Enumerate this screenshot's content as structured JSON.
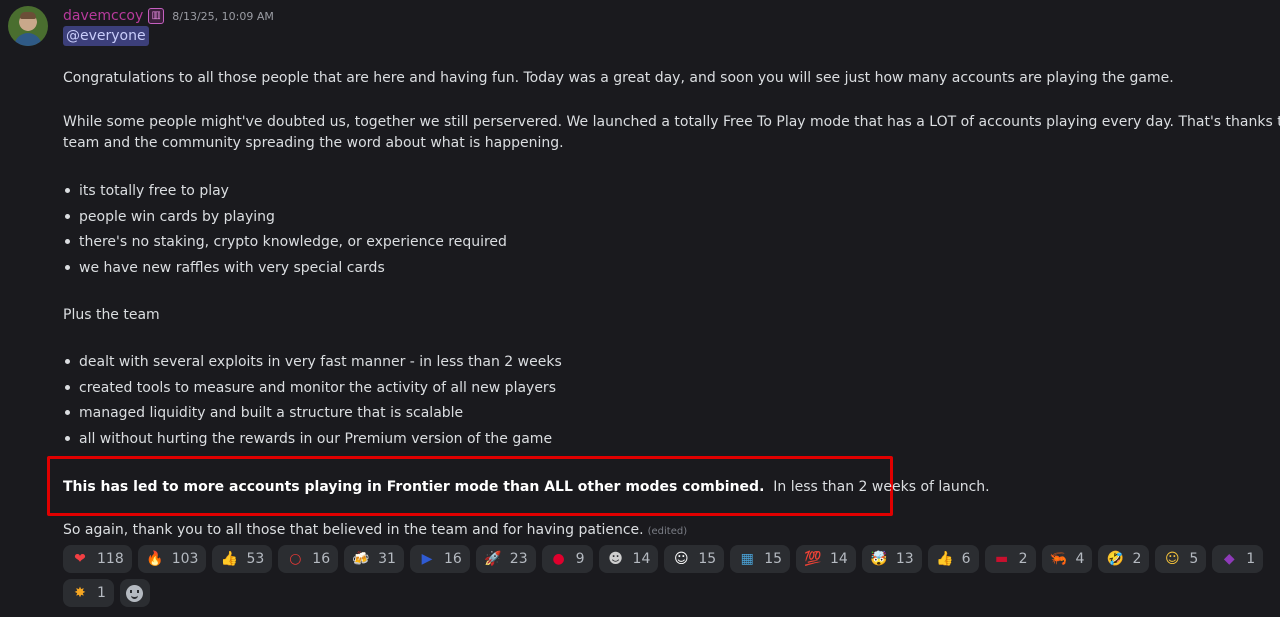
{
  "message": {
    "author": "davemccoy",
    "timestamp": "8/13/25, 10:09 AM",
    "mention": "@everyone",
    "paragraph1": "Congratulations to all those people that are here and having fun.  Today was a great day, and soon you will see just how many accounts are playing the game.",
    "paragraph2_line1": "While some people might've doubted us, together we still perservered.  We launched a totally Free To Play mode that has a LOT of accounts playing every day.  That's thanks to the",
    "paragraph2_line2": "team and the community spreading the word about what is happening.",
    "list1": [
      "its totally free to play",
      "people win cards by playing",
      "there's no staking, crypto knowledge, or experience required",
      "we have new raffles with very special cards"
    ],
    "plus_team": "Plus the team",
    "list2": [
      "dealt with several exploits in very fast manner - in less than 2 weeks",
      "created tools to measure and monitor the activity of all new players",
      "managed liquidity and built a structure that is scalable",
      "all without hurting the rewards in our Premium version of the game"
    ],
    "highlight_bold": "This has led to more accounts playing in Frontier mode than ALL other modes combined.",
    "highlight_rest": "In less than 2 weeks of launch.",
    "closing": "So again, thank you to all those that believed in the team and for having patience.",
    "edited_label": "(edited)"
  },
  "reactions": [
    {
      "emoji": "heart",
      "glyph": "❤",
      "color": "#f23f43",
      "count": "118"
    },
    {
      "emoji": "fire",
      "glyph": "🔥",
      "color": "#ff8a1f",
      "count": "103"
    },
    {
      "emoji": "thumbs-up",
      "glyph": "👍",
      "color": "#f5c33b",
      "count": "53"
    },
    {
      "emoji": "red-circle",
      "glyph": "○",
      "color": "#e53935",
      "count": "16"
    },
    {
      "emoji": "beers",
      "glyph": "🍻",
      "color": "#f2a93b",
      "count": "31"
    },
    {
      "emoji": "philippines-flag",
      "glyph": "▶",
      "color": "#2f5bd3",
      "count": "16"
    },
    {
      "emoji": "rocket",
      "glyph": "🚀",
      "color": "#9bb4d9",
      "count": "23"
    },
    {
      "emoji": "japan-flag",
      "glyph": "●",
      "color": "#e0002d",
      "count": "9"
    },
    {
      "emoji": "monster-face",
      "glyph": "☻",
      "color": "#cfcfcf",
      "count": "14"
    },
    {
      "emoji": "grin-face",
      "glyph": "☺",
      "color": "#ffffff",
      "count": "15"
    },
    {
      "emoji": "island-map",
      "glyph": "▦",
      "color": "#4aa3d8",
      "count": "15"
    },
    {
      "emoji": "hundred-points",
      "glyph": "💯",
      "color": "#e0245e",
      "count": "14"
    },
    {
      "emoji": "exploding-face",
      "glyph": "🤯",
      "color": "#f5a623",
      "count": "13"
    },
    {
      "emoji": "thumbs-up-brown",
      "glyph": "👍",
      "color": "#b07a4e",
      "count": "6"
    },
    {
      "emoji": "kenya-flag",
      "glyph": "▬",
      "color": "#c8102e",
      "count": "2"
    },
    {
      "emoji": "shrimp",
      "glyph": "🦐",
      "color": "#f08a5d",
      "count": "4"
    },
    {
      "emoji": "rofl",
      "glyph": "🤣",
      "color": "#f5c33b",
      "count": "2"
    },
    {
      "emoji": "face-with-monocle",
      "glyph": "☺",
      "color": "#f5c33b",
      "count": "5"
    },
    {
      "emoji": "ninja",
      "glyph": "◆",
      "color": "#8e3ab8",
      "count": "1"
    },
    {
      "emoji": "fire-character",
      "glyph": "✸",
      "color": "#f5a623",
      "count": "1"
    }
  ]
}
